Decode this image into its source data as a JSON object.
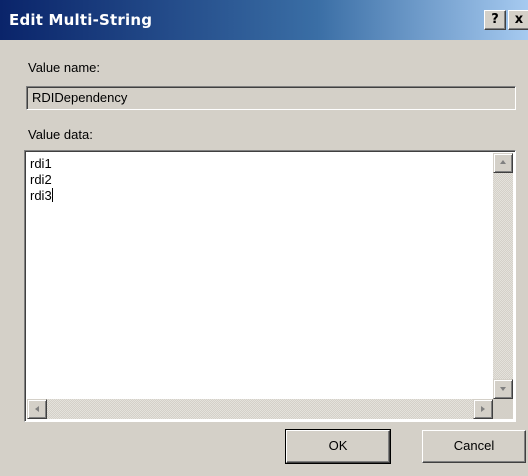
{
  "window": {
    "title": "Edit Multi-String",
    "help_label": "?",
    "close_label": "x"
  },
  "value_name": {
    "label": "Value name:",
    "value": "RDIDependency"
  },
  "value_data": {
    "label": "Value data:",
    "lines": [
      "rdi1",
      "rdi2",
      "rdi3"
    ]
  },
  "buttons": {
    "ok_label": "OK",
    "cancel_label": "Cancel"
  },
  "icons": {
    "scroll_up": "arrow-up-icon",
    "scroll_down": "arrow-down-icon",
    "scroll_left": "arrow-left-icon",
    "scroll_right": "arrow-right-icon"
  },
  "colors": {
    "titlebar_start": "#0a246a",
    "titlebar_end": "#a6caf0",
    "face": "#d4d0c8"
  }
}
